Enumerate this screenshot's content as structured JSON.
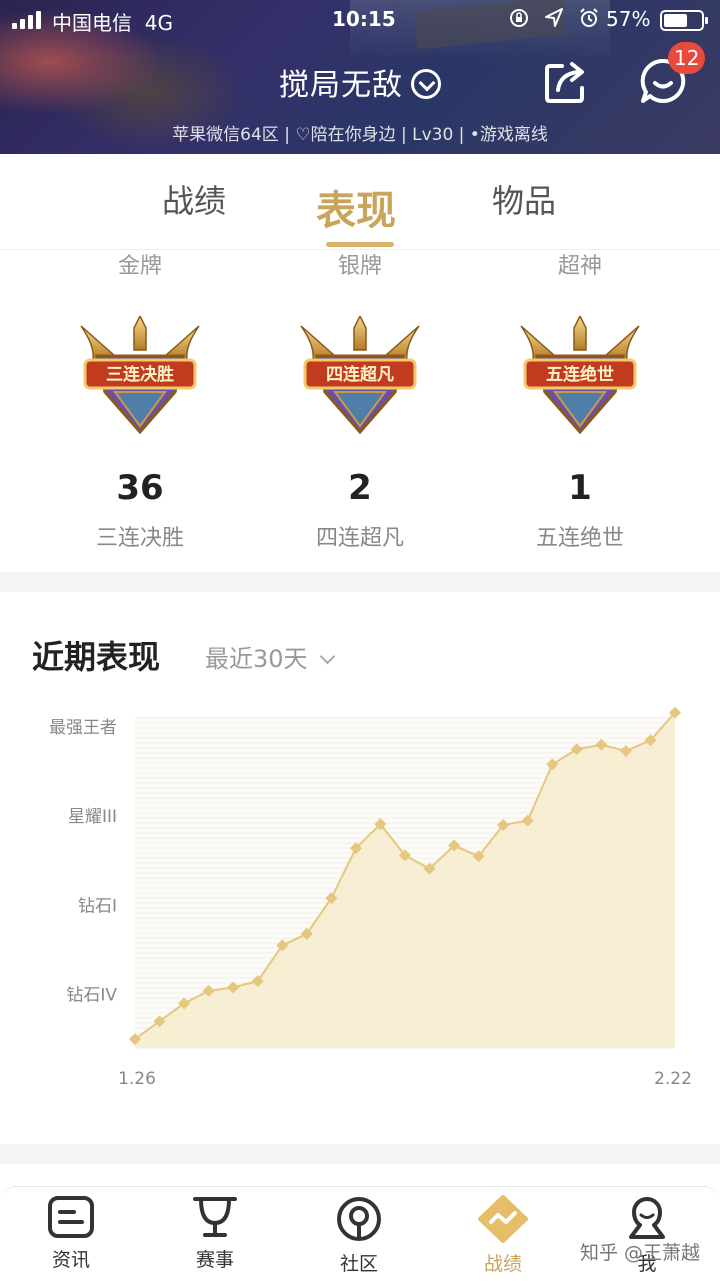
{
  "status_bar": {
    "carrier": "中国电信",
    "network": "4G",
    "time": "10:15",
    "battery": "57%",
    "battery_level": 0.57
  },
  "header": {
    "player_name": "搅局无敌",
    "meta": "苹果微信64区 | ♡陪在你身边 | Lv30 | •游戏离线",
    "badge_count": "12"
  },
  "tabs": [
    {
      "label": "战绩"
    },
    {
      "label": "表现"
    },
    {
      "label": "物品"
    }
  ],
  "medals": [
    {
      "tier": "金牌",
      "emblem": "三连决胜",
      "count": "36",
      "name": "三连决胜"
    },
    {
      "tier": "银牌",
      "emblem": "四连超凡",
      "count": "2",
      "name": "四连超凡"
    },
    {
      "tier": "超神",
      "emblem": "五连绝世",
      "count": "1",
      "name": "五连绝世"
    }
  ],
  "recent": {
    "title": "近期表现",
    "filter": "最近30天"
  },
  "chart_data": {
    "type": "area",
    "title": "",
    "xlabel": "",
    "ylabel": "",
    "x_tick_labels": [
      "1.26",
      "2.22"
    ],
    "y_tick_labels": [
      "最强王者",
      "星耀III",
      "钻石I",
      "钻石IV"
    ],
    "y_tick_values": [
      36,
      26,
      16,
      6
    ],
    "ylim": [
      0,
      37
    ],
    "series": [
      {
        "values": [
          1,
          3,
          5,
          6.4,
          6.8,
          7.5,
          11.5,
          12.8,
          16.8,
          22.4,
          25.1,
          21.6,
          20.1,
          22.7,
          21.5,
          25,
          25.5,
          31.8,
          33.5,
          34,
          33.3,
          34.5,
          37.6
        ]
      }
    ],
    "grid": true,
    "color": "#e5c77e",
    "fill_color": "#f7ebcc"
  },
  "bottom_nav": [
    {
      "label": "资讯",
      "icon": "news-icon"
    },
    {
      "label": "赛事",
      "icon": "trophy-icon"
    },
    {
      "label": "社区",
      "icon": "community-icon"
    },
    {
      "label": "战绩",
      "icon": "record-icon",
      "active": true
    },
    {
      "label": "我",
      "icon": "profile-icon"
    }
  ],
  "watermark": "知乎 @王萧越"
}
